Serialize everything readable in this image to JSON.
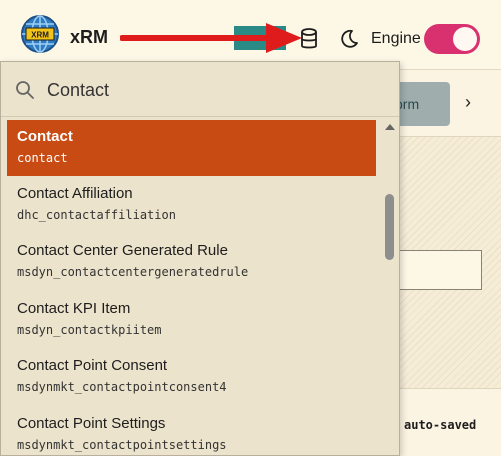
{
  "header": {
    "app_name": "xRM",
    "logo_text": "XRM",
    "engine_label": "Engine",
    "engine_enabled": true,
    "icons": [
      "globe-logo-icon",
      "arrow-annotation",
      "database-icon",
      "moon-icon"
    ],
    "colors": {
      "toggle": "#d9306f",
      "arrow": "#e01b1b",
      "teal": "#2a8a86"
    }
  },
  "background": {
    "form_button_label": "orm",
    "next_label": "›",
    "autosaved_label": "auto-saved"
  },
  "dropdown": {
    "search_value": "Contact",
    "search_icon": "search-icon",
    "selected_color": "#c84b14",
    "items": [
      {
        "title": "Contact",
        "logical_name": "contact",
        "selected": true
      },
      {
        "title": "Contact Affiliation",
        "logical_name": "dhc_contactaffiliation",
        "selected": false
      },
      {
        "title": "Contact Center Generated Rule",
        "logical_name": "msdyn_contactcentergeneratedrule",
        "selected": false
      },
      {
        "title": "Contact KPI Item",
        "logical_name": "msdyn_contactkpiitem",
        "selected": false
      },
      {
        "title": "Contact Point Consent",
        "logical_name": "msdynmkt_contactpointconsent4",
        "selected": false
      },
      {
        "title": "Contact Point Settings",
        "logical_name": "msdynmkt_contactpointsettings",
        "selected": false
      }
    ]
  }
}
